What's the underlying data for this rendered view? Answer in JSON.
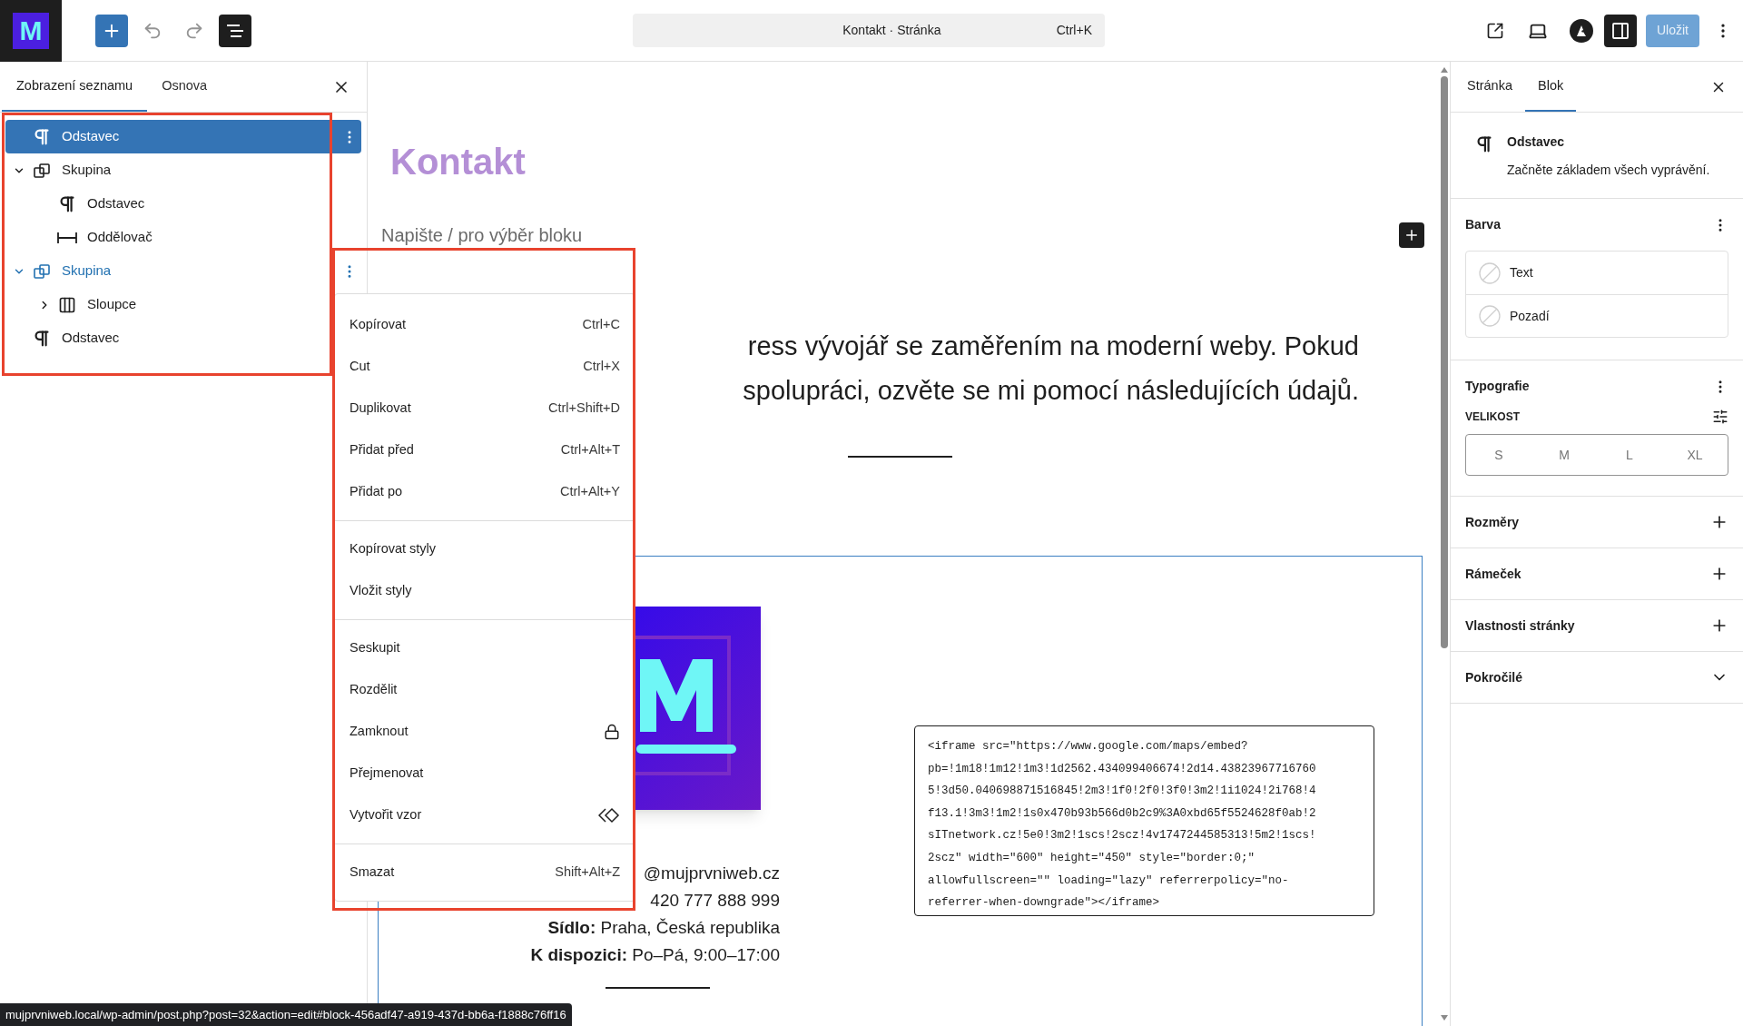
{
  "toolbar": {
    "logo_letter": "M",
    "title": "Kontakt · Stránka",
    "shortcut": "Ctrl+K",
    "save": "Uložit"
  },
  "list_panel": {
    "tabs": [
      {
        "label": "Zobrazení seznamu",
        "selected": true
      },
      {
        "label": "Osnova",
        "selected": false
      }
    ],
    "items": [
      {
        "label": "Odstavec",
        "kind": "paragraph",
        "selected": true,
        "menu_open": false
      },
      {
        "label": "Skupina",
        "kind": "group",
        "selected": false,
        "menu_open": false,
        "expanded": true,
        "children": [
          {
            "label": "Odstavec",
            "kind": "paragraph",
            "selected": false,
            "menu_open": false
          },
          {
            "label": "Oddělovač",
            "kind": "separator",
            "selected": false,
            "menu_open": false
          }
        ]
      },
      {
        "label": "Skupina",
        "kind": "group",
        "selected": false,
        "menu_open": true,
        "expanded": true,
        "children": [
          {
            "label": "Sloupce",
            "kind": "columns",
            "selected": false,
            "menu_open": false,
            "expanded": false
          }
        ]
      },
      {
        "label": "Odstavec",
        "kind": "paragraph",
        "selected": false,
        "menu_open": false
      }
    ]
  },
  "context_menu": {
    "groups": [
      [
        {
          "label": "Kopírovat",
          "shortcut": "Ctrl+C"
        },
        {
          "label": "Cut",
          "shortcut": "Ctrl+X"
        },
        {
          "label": "Duplikovat",
          "shortcut": "Ctrl+Shift+D"
        },
        {
          "label": "Přidat před",
          "shortcut": "Ctrl+Alt+T"
        },
        {
          "label": "Přidat po",
          "shortcut": "Ctrl+Alt+Y"
        }
      ],
      [
        {
          "label": "Kopírovat styly"
        },
        {
          "label": "Vložit styly"
        }
      ],
      [
        {
          "label": "Seskupit"
        },
        {
          "label": "Rozdělit"
        },
        {
          "label": "Zamknout",
          "kind": "lock"
        },
        {
          "label": "Přejmenovat"
        },
        {
          "label": "Vytvořit vzor",
          "kind": "pattern"
        }
      ],
      [
        {
          "label": "Smazat",
          "shortcut": "Shift+Alt+Z"
        }
      ]
    ]
  },
  "canvas": {
    "heading": "Kontakt",
    "placeholder": "Napište / pro výběr bloku",
    "paragraph_lines": [
      "ress vývojář se zaměřením na moderní weby. Pokud",
      "spolupráci, ozvěte se mi pomocí následujících údajů."
    ],
    "image": {
      "kind": "picture"
    },
    "contact_lines": [
      "@mujprvniweb.cz",
      "420 777 888 999",
      "**Sídlo:** Praha, Česká republika",
      "**K dispozici:** Po–Pá, 9:00–17:00"
    ],
    "code_lines": [
      "<iframe src=\"https://www.google.com/maps/embed?",
      "pb=!1m18!1m12!1m3!1d2562.434099406674!2d14.43823967716760",
      "5!3d50.040698871516845!2m3!1f0!2f0!3f0!3m2!1i1024!2i768!4",
      "f13.1!3m3!1m2!1s0x470b93b566d0b2c9%3A0xbd65f5524628f0ab!2",
      "sITnetwork.cz!5e0!3m2!1scs!2scz!4v1747244585313!5m2!1scs!",
      "2scz\" width=\"600\" height=\"450\" style=\"border:0;\"",
      "allowfullscreen=\"\" loading=\"lazy\" referrerpolicy=\"no-",
      "referrer-when-downgrade\"></iframe>"
    ]
  },
  "settings": {
    "tabs": [
      {
        "label": "Stránka",
        "selected": false
      },
      {
        "label": "Blok",
        "selected": true
      }
    ],
    "block": {
      "name": "Odstavec",
      "description": "Začněte základem všech vyprávění."
    },
    "color": {
      "title": "Barva",
      "items": [
        "Text",
        "Pozadí"
      ]
    },
    "typography": {
      "title": "Typografie",
      "size_label": "VELIKOST",
      "sizes": [
        "S",
        "M",
        "L",
        "XL"
      ]
    },
    "panels": [
      {
        "label": "Rozměry",
        "kind": "add"
      },
      {
        "label": "Rámeček",
        "kind": "add"
      },
      {
        "label": "Vlastnosti stránky",
        "kind": "add"
      },
      {
        "label": "Pokročilé",
        "kind": "expand"
      }
    ]
  },
  "status_url": "mujprvniweb.local/wp-admin/post.php?post=32&action=edit#block-456adf47-a919-437d-bb6a-f1888c76ff16"
}
